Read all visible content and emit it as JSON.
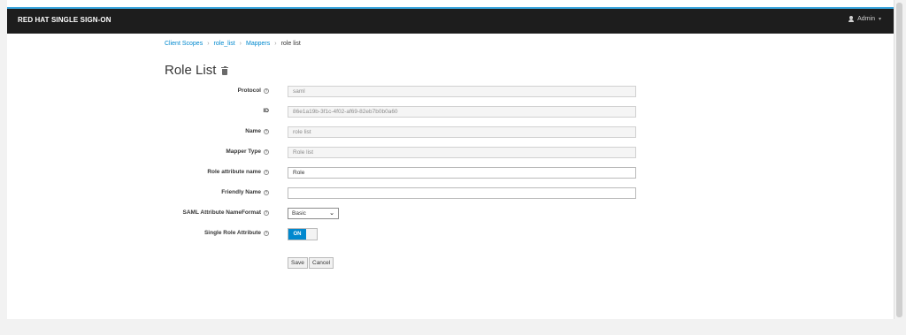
{
  "header": {
    "brand": "RED HAT SINGLE SIGN-ON",
    "user": "Admin"
  },
  "breadcrumb": [
    {
      "label": "Client Scopes"
    },
    {
      "label": "role_list"
    },
    {
      "label": "Mappers"
    },
    {
      "label": "role list"
    }
  ],
  "page": {
    "title": "Role List"
  },
  "form": {
    "protocol": {
      "label": "Protocol",
      "value": "saml"
    },
    "id": {
      "label": "ID",
      "value": "86e1a19b-3f1c-4f02-af69-82eb7b0b0a60"
    },
    "name": {
      "label": "Name",
      "value": "role list"
    },
    "mapper_type": {
      "label": "Mapper Type",
      "value": "Role list"
    },
    "role_attribute_name": {
      "label": "Role attribute name",
      "value": "Role"
    },
    "friendly_name": {
      "label": "Friendly Name",
      "value": ""
    },
    "saml_nameformat": {
      "label": "SAML Attribute NameFormat",
      "value": "Basic"
    },
    "single_role": {
      "label": "Single Role Attribute",
      "value": "ON"
    }
  },
  "actions": {
    "save": "Save",
    "cancel": "Cancel"
  },
  "colors": {
    "accent": "#0088ce",
    "topbar": "#1d1d1d",
    "topbar_stripe": "#39a5dc"
  }
}
